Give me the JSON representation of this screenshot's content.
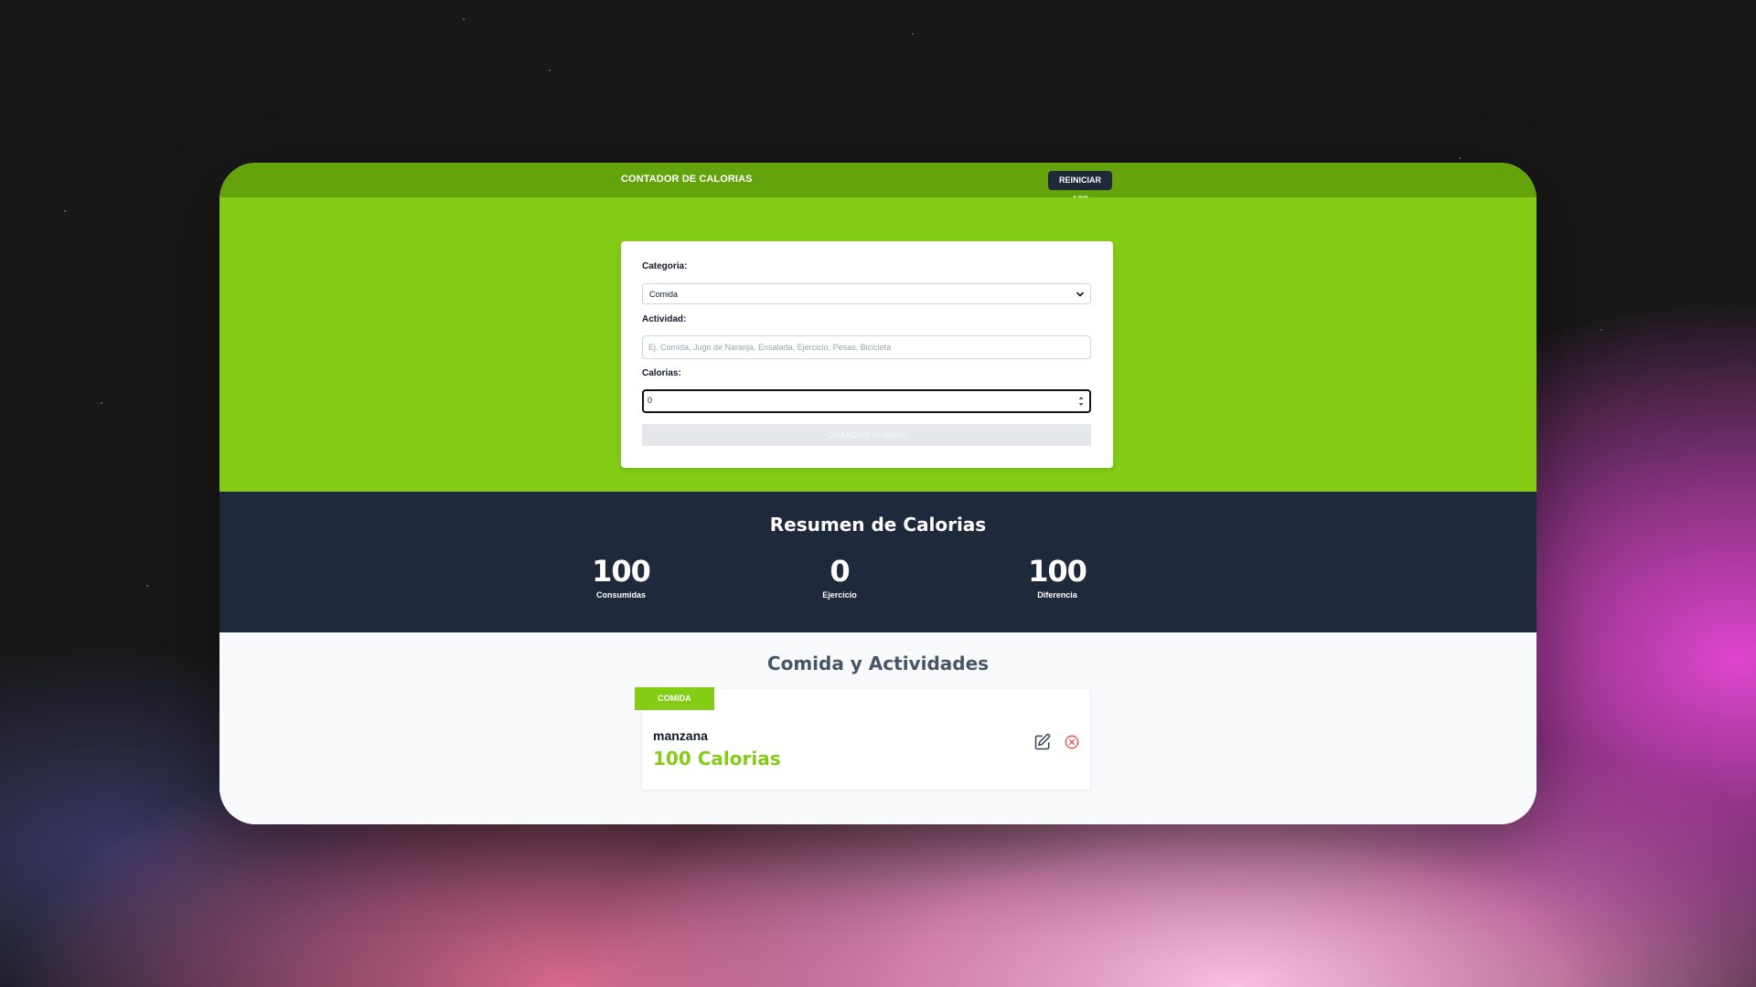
{
  "header": {
    "title": "CONTADOR DE CALORIAS",
    "reset_button": "REINICIAR APP"
  },
  "form": {
    "category_label": "Categoria:",
    "category_selected": "Comida",
    "activity_label": "Actividad:",
    "activity_placeholder": "Ej. Comida, Jugo de Naranja, Ensalada, Ejercicio, Pesas, Bicicleta",
    "calories_label": "Calorias:",
    "calories_value": "0",
    "submit_label": "GUARDAR COMIDA"
  },
  "summary": {
    "title": "Resumen de Calorias",
    "stats": [
      {
        "value": "100",
        "label": "Consumidas"
      },
      {
        "value": "0",
        "label": "Ejercicio"
      },
      {
        "value": "100",
        "label": "Diferencia"
      }
    ]
  },
  "activities": {
    "title": "Comida y Actividades",
    "items": [
      {
        "category": "COMIDA",
        "name": "manzana",
        "calories": "100 Calorias",
        "edit_icon": "edit-icon",
        "delete_icon": "close-circle-icon"
      }
    ]
  },
  "colors": {
    "header_green": "#65a30d",
    "form_green": "#84cc16",
    "summary_bg": "#1e293b",
    "reset_button_bg": "#1f2937",
    "delete_icon_red": "#ef4444"
  }
}
